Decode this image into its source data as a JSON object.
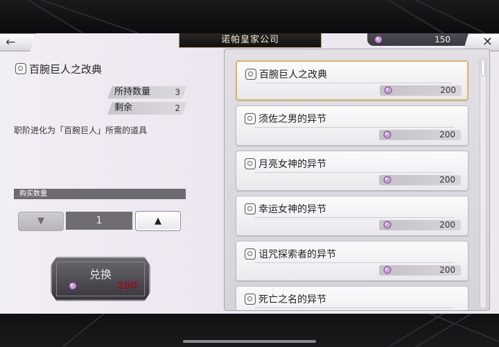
{
  "header": {
    "title": "诺帕皇家公司",
    "currency_amount": "150",
    "back_icon": "arrow-left-icon",
    "close_icon": "close-icon"
  },
  "detail": {
    "item_name": "百腕巨人之改典",
    "owned_label": "所持数量",
    "owned_value": "3",
    "remaining_label": "剩余",
    "remaining_value": "2",
    "description": "职阶进化为「百腕巨人」所需的道具"
  },
  "purchase": {
    "qty_label": "购买数量",
    "quantity": "1",
    "down_symbol": "▼",
    "up_symbol": "▲",
    "exchange_label": "兑换",
    "exchange_price": "200"
  },
  "shop_list": {
    "items": [
      {
        "name": "百腕巨人之改典",
        "price": "200",
        "selected": true
      },
      {
        "name": "须佐之男的异节",
        "price": "200",
        "selected": false
      },
      {
        "name": "月亮女神的异节",
        "price": "200",
        "selected": false
      },
      {
        "name": "幸运女神的异节",
        "price": "200",
        "selected": false
      },
      {
        "name": "诅咒探索者的异节",
        "price": "200",
        "selected": false
      },
      {
        "name": "死亡之名的异节",
        "price": "",
        "selected": false
      }
    ]
  },
  "colors": {
    "gem": "#c9a0d8",
    "selected_border": "#d7b573",
    "exchange_price": "#8a1520"
  }
}
